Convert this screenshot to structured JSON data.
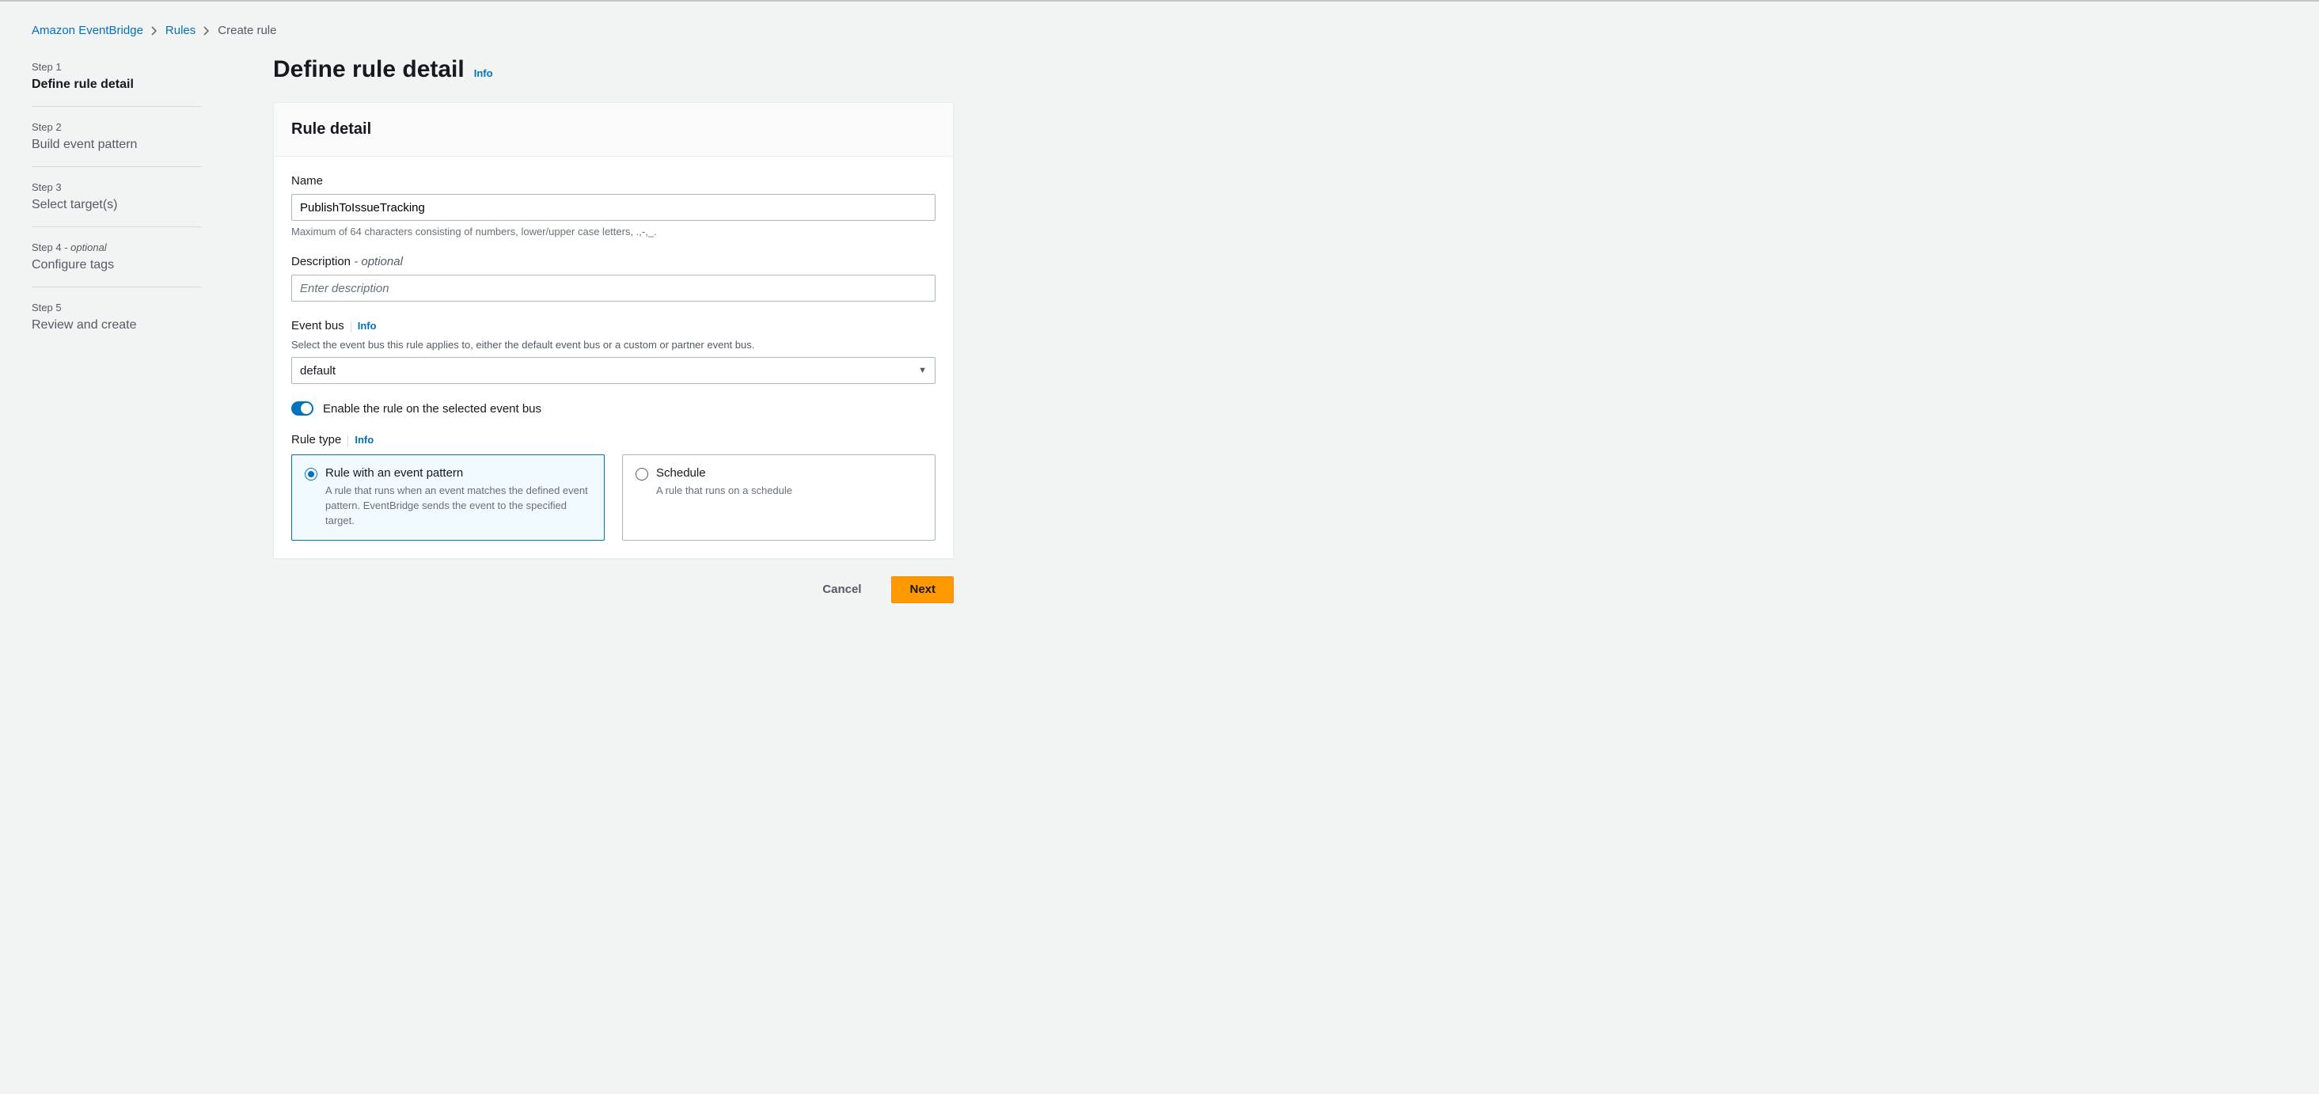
{
  "breadcrumb": {
    "items": [
      {
        "label": "Amazon EventBridge"
      },
      {
        "label": "Rules"
      }
    ],
    "current": "Create rule"
  },
  "steps": [
    {
      "label": "Step 1",
      "title": "Define rule detail",
      "optional": false,
      "active": true
    },
    {
      "label": "Step 2",
      "title": "Build event pattern",
      "optional": false,
      "active": false
    },
    {
      "label": "Step 3",
      "title": "Select target(s)",
      "optional": false,
      "active": false
    },
    {
      "label": "Step 4",
      "title": "Configure tags",
      "optional": true,
      "active": false
    },
    {
      "label": "Step 5",
      "title": "Review and create",
      "optional": false,
      "active": false
    }
  ],
  "optionalSuffix": " - optional",
  "page": {
    "title": "Define rule detail",
    "infoLabel": "Info"
  },
  "card": {
    "title": "Rule detail"
  },
  "form": {
    "name": {
      "label": "Name",
      "value": "PublishToIssueTracking",
      "helper": "Maximum of 64 characters consisting of numbers, lower/upper case letters, .,-,_."
    },
    "description": {
      "label": "Description",
      "optional": "- optional",
      "placeholder": "Enter description",
      "value": ""
    },
    "eventBus": {
      "label": "Event bus",
      "info": "Info",
      "helper": "Select the event bus this rule applies to, either the default event bus or a custom or partner event bus.",
      "value": "default"
    },
    "enableToggle": {
      "label": "Enable the rule on the selected event bus",
      "on": true
    },
    "ruleType": {
      "label": "Rule type",
      "info": "Info",
      "options": [
        {
          "title": "Rule with an event pattern",
          "desc": "A rule that runs when an event matches the defined event pattern. EventBridge sends the event to the specified target.",
          "selected": true
        },
        {
          "title": "Schedule",
          "desc": "A rule that runs on a schedule",
          "selected": false
        }
      ]
    }
  },
  "actions": {
    "cancel": "Cancel",
    "next": "Next"
  }
}
